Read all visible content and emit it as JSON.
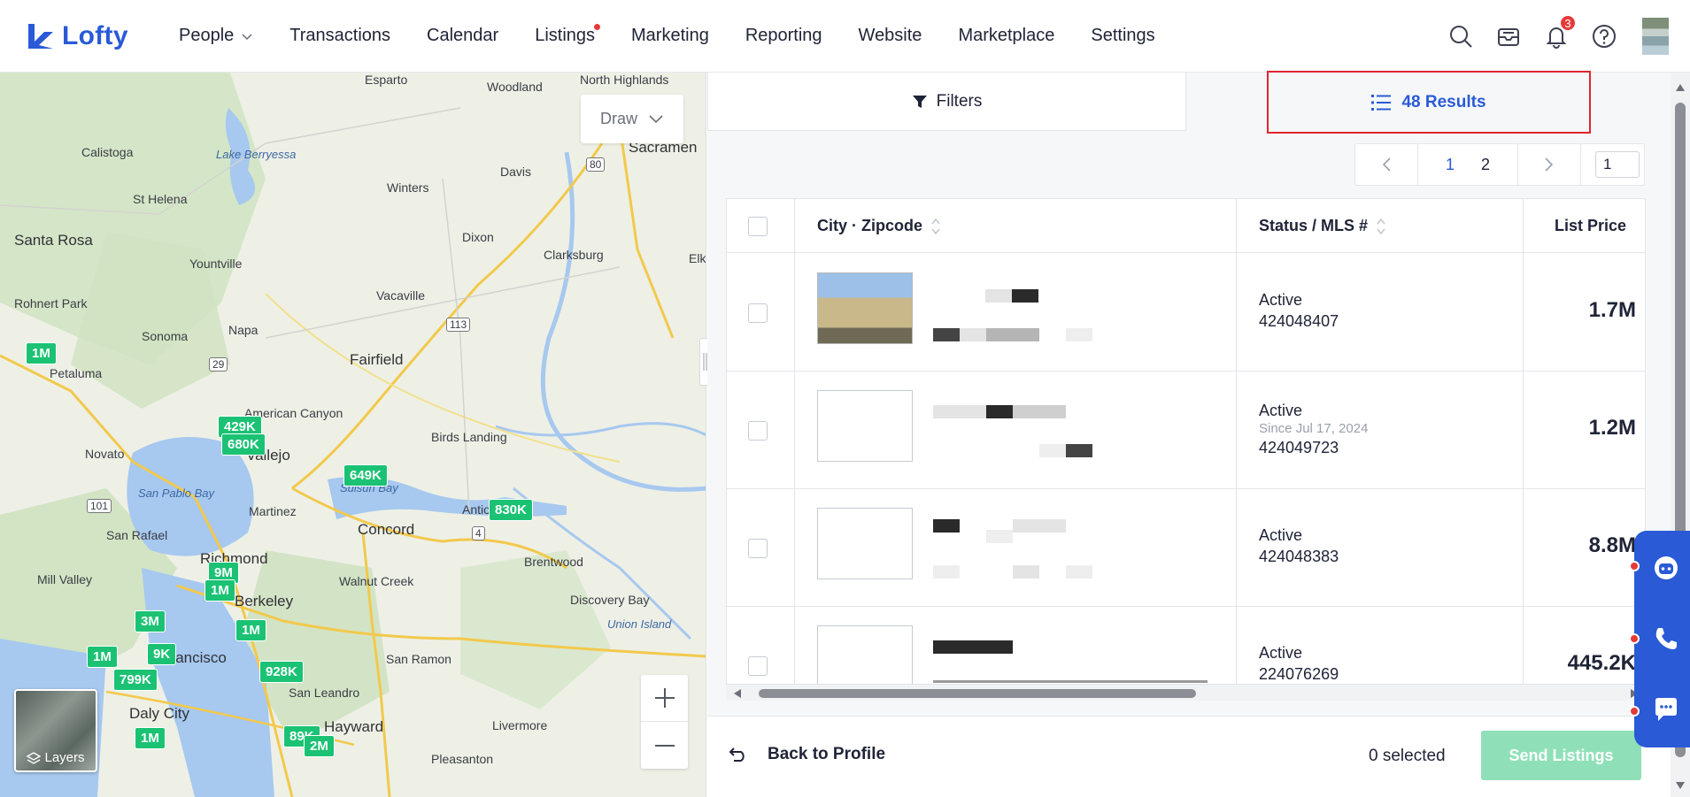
{
  "app": {
    "brand": "Lofty"
  },
  "nav": {
    "items": [
      {
        "label": "People",
        "has_dropdown": true
      },
      {
        "label": "Transactions"
      },
      {
        "label": "Calendar"
      },
      {
        "label": "Listings",
        "has_dot": true
      },
      {
        "label": "Marketing"
      },
      {
        "label": "Reporting"
      },
      {
        "label": "Website"
      },
      {
        "label": "Marketplace"
      },
      {
        "label": "Settings"
      }
    ],
    "notification_count": "3",
    "icons": [
      "search-icon",
      "inbox-icon",
      "bell-icon",
      "help-icon"
    ]
  },
  "map": {
    "draw_label": "Draw",
    "layers_label": "Layers",
    "place_labels": {
      "esparto": "Esparto",
      "woodland": "Woodland",
      "north_highlands": "North Highlands",
      "lake_berryessa": "Lake Berryessa",
      "sacramento": "Sacramen",
      "calistoga": "Calistoga",
      "davis": "Davis",
      "winters": "Winters",
      "st_helena": "St Helena",
      "dixon": "Dixon",
      "santa_rosa": "Santa Rosa",
      "clarksburg": "Clarksburg",
      "elk": "Elk",
      "yountville": "Yountville",
      "vacaville": "Vacaville",
      "rohnert_park": "Rohnert Park",
      "sonoma": "Sonoma",
      "napa": "Napa",
      "fairfield": "Fairfield",
      "petaluma": "Petaluma",
      "american_canyon": "American Canyon",
      "birds_landing": "Birds Landing",
      "vallejo": "Vallejo",
      "novato": "Novato",
      "san_pablo_bay": "San Pablo Bay",
      "suisun_bay": "Suisun Bay",
      "antioch": "Antio",
      "martinez": "Martinez",
      "concord": "Concord",
      "san_rafael": "San Rafael",
      "brentwood": "Brentwood",
      "richmond": "Richmond",
      "mill_valley": "Mill Valley",
      "walnut_creek": "Walnut Creek",
      "discovery_bay": "Discovery Bay",
      "berkeley": "Berkeley",
      "union_island": "Union Island",
      "san_francisco": "n Francisco",
      "san_ramon": "San Ramon",
      "daly_city": "Daly City",
      "san_leandro": "San Leandro",
      "hayward": "Hayward",
      "livermore": "Livermore",
      "pleasanton": "Pleasanton",
      "hwy_80": "80",
      "hwy_113": "113",
      "hwy_29": "29",
      "hwy_101": "101",
      "hwy_4": "4"
    },
    "price_pins": [
      "1M",
      "429K",
      "680K",
      "649K",
      "830K",
      "9M",
      "1M",
      "1M",
      "3M",
      "1M",
      "799K",
      "9K",
      "928K",
      "1M",
      "89K",
      "2M"
    ]
  },
  "panel": {
    "tab_filters": "Filters",
    "tab_results": "48 Results",
    "pagination": {
      "pages": [
        "1",
        "2"
      ],
      "current_page": "1",
      "jump_value": "1"
    },
    "table": {
      "columns": [
        "City · Zipcode",
        "Status / MLS #",
        "List Price"
      ],
      "rows": [
        {
          "status": "Active",
          "since": "",
          "mls": "424048407",
          "price": "1.7M",
          "has_photo": true
        },
        {
          "status": "Active",
          "since": "Since Jul 17, 2024",
          "mls": "424049723",
          "price": "1.2M",
          "has_photo": false
        },
        {
          "status": "Active",
          "since": "",
          "mls": "424048383",
          "price": "8.8M",
          "has_photo": false
        },
        {
          "status": "Active",
          "since": "",
          "mls": "224076269",
          "price": "445.2K",
          "has_photo": false
        }
      ]
    },
    "footer": {
      "back_label": "Back to Profile",
      "selected_label": "0 selected",
      "send_label": "Send Listings"
    }
  },
  "colors": {
    "brand": "#2a5ad6",
    "accent_green": "#1bc274",
    "alert_red": "#e5393a"
  }
}
